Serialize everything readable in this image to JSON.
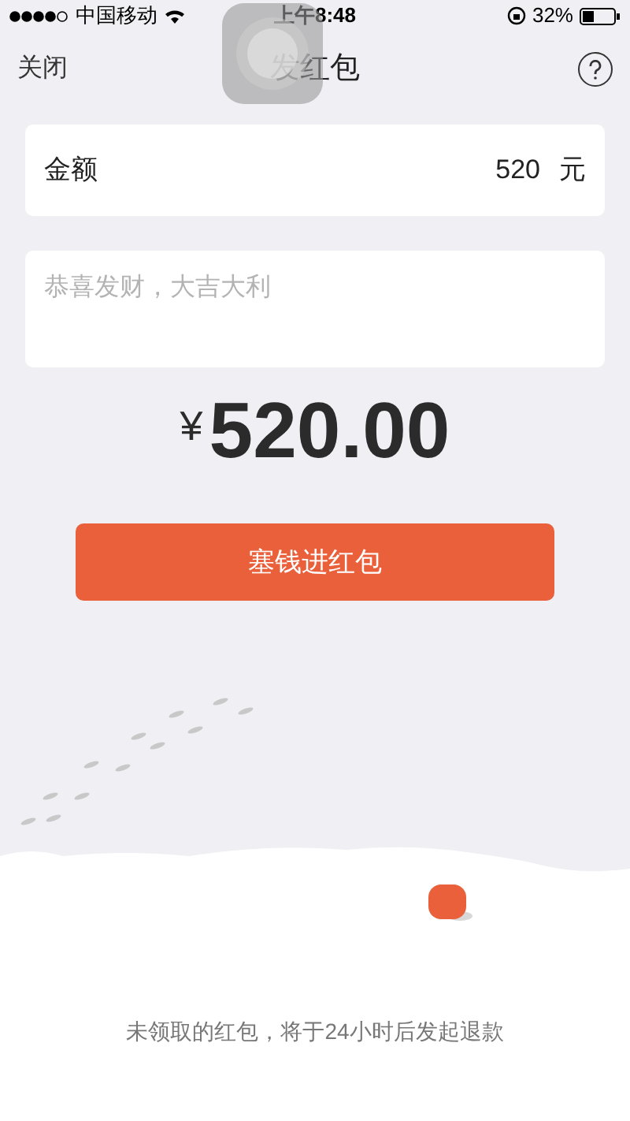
{
  "status_bar": {
    "carrier": "中国移动",
    "time": "上午8:48",
    "battery": "32%"
  },
  "nav": {
    "close": "关闭",
    "title": "发红包"
  },
  "amount": {
    "label": "金额",
    "value": "520",
    "unit": "元"
  },
  "message": {
    "placeholder": "恭喜发财，大吉大利"
  },
  "total": {
    "currency": "¥",
    "value": "520.00"
  },
  "submit": {
    "label": "塞钱进红包"
  },
  "footer_note": "未领取的红包，将于24小时后发起退款"
}
